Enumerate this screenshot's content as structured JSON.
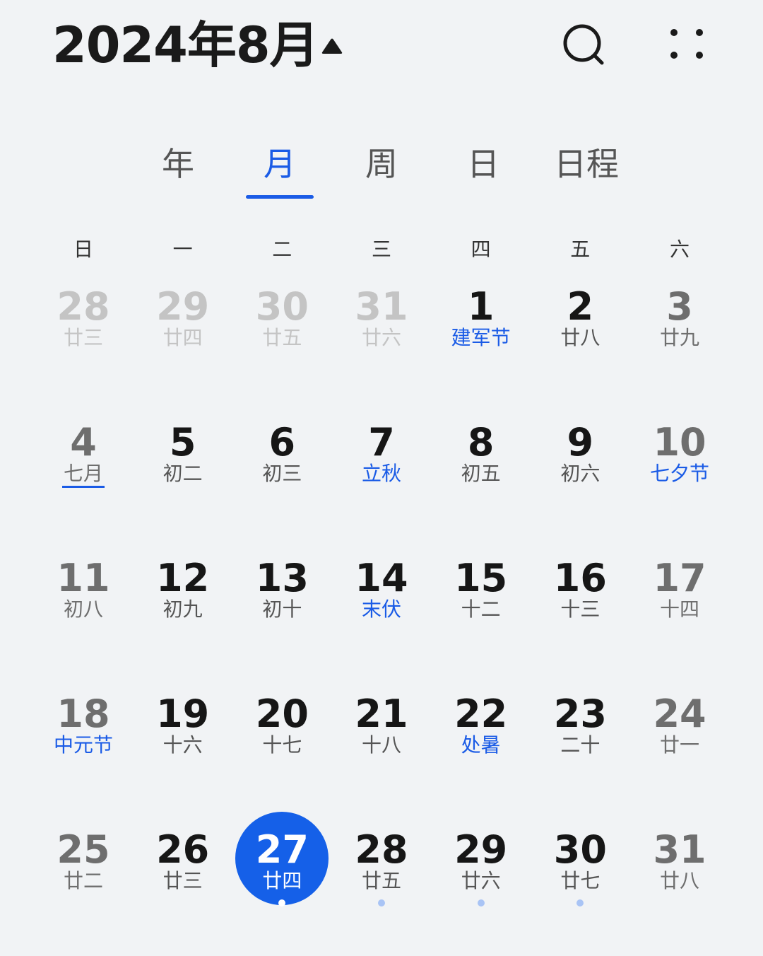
{
  "header": {
    "title": "2024年8月",
    "toggle_icon": "triangle-up-icon",
    "search_icon": "search-icon",
    "more_icon": "four-dots-icon"
  },
  "tabs": [
    {
      "label": "年",
      "active": false
    },
    {
      "label": "月",
      "active": true
    },
    {
      "label": "周",
      "active": false
    },
    {
      "label": "日",
      "active": false
    },
    {
      "label": "日程",
      "active": false
    }
  ],
  "weekdays": [
    "日",
    "一",
    "二",
    "三",
    "四",
    "五",
    "六"
  ],
  "colors": {
    "accent": "#1a5be6",
    "today_circle": "#1560e8",
    "event_dot": "#a9c4f5",
    "background": "#f1f3f5"
  },
  "days": [
    {
      "num": "28",
      "sub": "廿三",
      "other": true
    },
    {
      "num": "29",
      "sub": "廿四",
      "other": true
    },
    {
      "num": "30",
      "sub": "廿五",
      "other": true
    },
    {
      "num": "31",
      "sub": "廿六",
      "other": true
    },
    {
      "num": "1",
      "sub": "建军节",
      "festival": true
    },
    {
      "num": "2",
      "sub": "廿八"
    },
    {
      "num": "3",
      "sub": "廿九"
    },
    {
      "num": "4",
      "sub": "七月",
      "underline": true
    },
    {
      "num": "5",
      "sub": "初二"
    },
    {
      "num": "6",
      "sub": "初三"
    },
    {
      "num": "7",
      "sub": "立秋",
      "festival": true
    },
    {
      "num": "8",
      "sub": "初五"
    },
    {
      "num": "9",
      "sub": "初六"
    },
    {
      "num": "10",
      "sub": "七夕节",
      "festival": true
    },
    {
      "num": "11",
      "sub": "初八"
    },
    {
      "num": "12",
      "sub": "初九"
    },
    {
      "num": "13",
      "sub": "初十"
    },
    {
      "num": "14",
      "sub": "末伏",
      "festival": true
    },
    {
      "num": "15",
      "sub": "十二"
    },
    {
      "num": "16",
      "sub": "十三"
    },
    {
      "num": "17",
      "sub": "十四"
    },
    {
      "num": "18",
      "sub": "中元节",
      "festival": true
    },
    {
      "num": "19",
      "sub": "十六"
    },
    {
      "num": "20",
      "sub": "十七"
    },
    {
      "num": "21",
      "sub": "十八"
    },
    {
      "num": "22",
      "sub": "处暑",
      "festival": true
    },
    {
      "num": "23",
      "sub": "二十"
    },
    {
      "num": "24",
      "sub": "廿一"
    },
    {
      "num": "25",
      "sub": "廿二"
    },
    {
      "num": "26",
      "sub": "廿三"
    },
    {
      "num": "27",
      "sub": "廿四",
      "today": true,
      "event": true
    },
    {
      "num": "28",
      "sub": "廿五",
      "event": true
    },
    {
      "num": "29",
      "sub": "廿六",
      "event": true
    },
    {
      "num": "30",
      "sub": "廿七",
      "event": true
    },
    {
      "num": "31",
      "sub": "廿八"
    }
  ]
}
